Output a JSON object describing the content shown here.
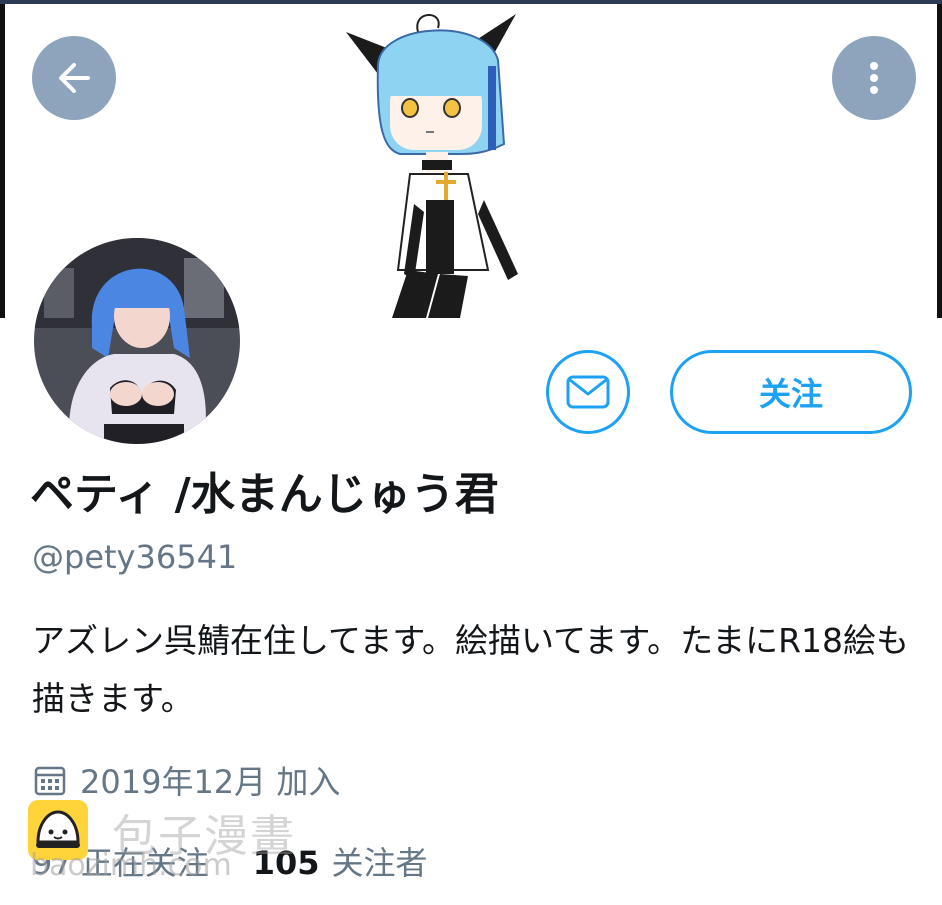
{
  "profile": {
    "display_name": "ペティ /水まんじゅう君",
    "handle": "@pety36541",
    "bio": "アズレン呉鯖在住してます。絵描いてます。たまにR18絵も描きます。",
    "joined": "2019年12月 加入"
  },
  "actions": {
    "back_icon": "arrow-left-icon",
    "more_icon": "vertical-dots-icon",
    "message_icon": "envelope-icon",
    "follow_label": "关注"
  },
  "stats": {
    "following_count": "97",
    "following_label": "正在关注",
    "followers_count": "105",
    "followers_label": "关注者"
  },
  "watermark": {
    "title": "包子漫畫",
    "url": "baozimh.com"
  },
  "colors": {
    "accent": "#1da1f2",
    "secondary_text": "#657786",
    "primary_text": "#14171a",
    "header_button": "#8ea3bc"
  }
}
